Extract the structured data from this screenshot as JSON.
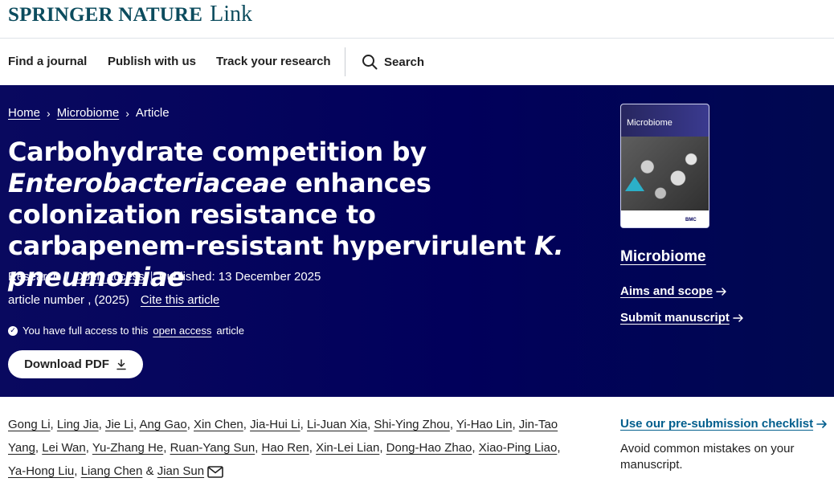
{
  "brand": {
    "name": "SPRINGER NATURE",
    "product": "Link"
  },
  "nav": {
    "items": [
      "Find a journal",
      "Publish with us",
      "Track your research"
    ],
    "search_label": "Search"
  },
  "breadcrumb": {
    "home": "Home",
    "journal": "Microbiome",
    "current": "Article",
    "separator": "›"
  },
  "article": {
    "title_1": "Carbohydrate competition by ",
    "title_2": "Enterobacteriaceae",
    "title_3": " enhances colonization resistance to carbapenem-resistant hypervirulent ",
    "title_4": "K. pneumoniae",
    "type": "Research",
    "access": "Open access",
    "published": "Published: 13 December 2025",
    "article_number": "article number , (2025)",
    "cite_label": "Cite this article",
    "access_note_prefix": "You have full access to this",
    "access_note_link": "open access",
    "access_note_suffix": "article",
    "download_label": "Download PDF"
  },
  "journal": {
    "cover_name": "Microbiome",
    "cover_publisher": "BMC",
    "title": "Microbiome",
    "aims_label": "Aims and scope",
    "submit_label": "Submit manuscript"
  },
  "authors": [
    "Gong Li",
    "Ling Jia",
    "Jie Li",
    "Ang Gao",
    "Xin Chen",
    "Jia-Hui Li",
    "Li-Juan Xia",
    "Shi-Ying Zhou",
    "Yi-Hao Lin",
    "Jin-Tao Yang",
    "Lei Wan",
    "Yu-Zhang He",
    "Ruan-Yang Sun",
    "Hao Ren",
    "Xin-Lei Lian",
    "Dong-Hao Zhao",
    "Xiao-Ping Liao",
    "Ya-Hong Liu",
    "Liang Chen",
    "Jian Sun"
  ],
  "checklist": {
    "label": "Use our pre-submission checklist",
    "note": "Avoid common mistakes on your manuscript."
  },
  "colors": {
    "hero": "#01005b",
    "brand": "#0c4c5e",
    "link_blue": "#025e8d"
  },
  "icons": [
    "search-icon",
    "chevron-right-icon",
    "check-circle-icon",
    "download-icon",
    "arrow-right-icon",
    "mail-icon"
  ]
}
